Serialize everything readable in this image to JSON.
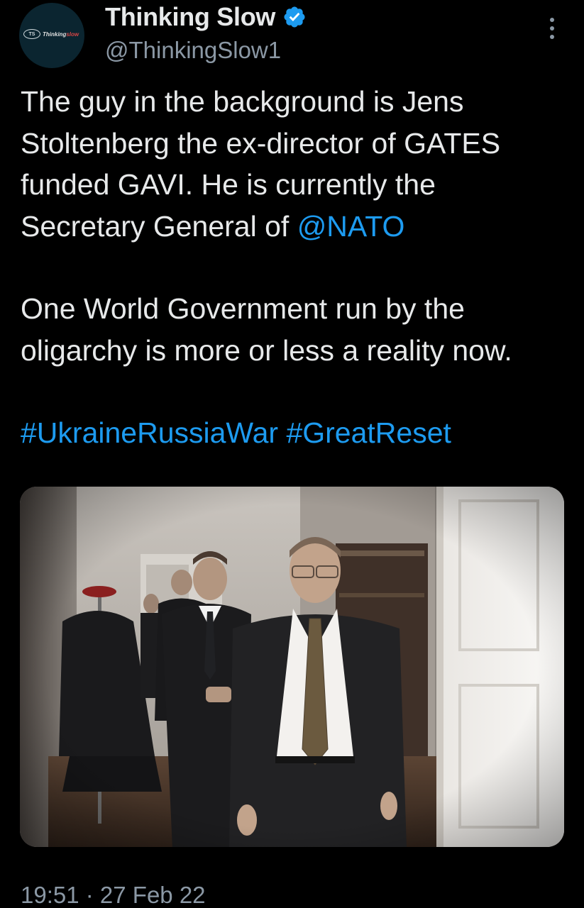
{
  "author": {
    "display_name": "Thinking Slow",
    "handle": "@ThinkingSlow1",
    "verified": true,
    "avatar_logo_text_main": "Thinking",
    "avatar_logo_text_accent": "slow",
    "avatar_logo_mark": "TS"
  },
  "tweet": {
    "line1": "The guy in the background is Jens Stoltenberg the ex-director of GATES funded GAVI.  He is currently the Secretary General of ",
    "mention": "@NATO",
    "line2": "One World Government run by the oligarchy is more or less a reality now.",
    "hashtag1": "#UkraineRussiaWar",
    "hashtag_separator": " ",
    "hashtag2": "#GreatReset"
  },
  "media": {
    "type": "photo",
    "description_icon": "photo-icon"
  },
  "meta": {
    "time": "19:51",
    "separator": " · ",
    "date": "27 Feb 22"
  },
  "colors": {
    "background": "#000000",
    "text_primary": "#e7e9ea",
    "text_secondary": "#8b98a5",
    "link": "#1d9bf0",
    "verified": "#1d9bf0"
  },
  "icons": {
    "verified": "verified-badge-icon",
    "more": "more-vertical-icon"
  }
}
